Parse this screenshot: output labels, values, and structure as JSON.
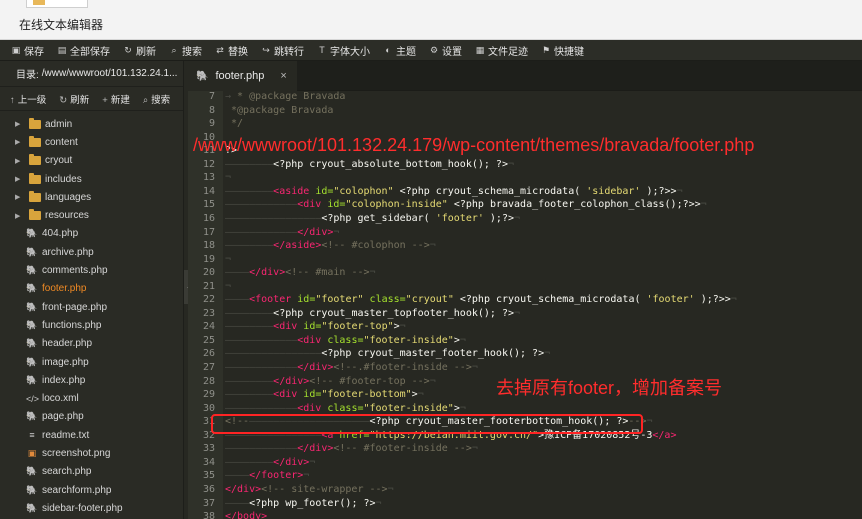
{
  "window": {
    "title": "在线文本编辑器"
  },
  "toolbar": {
    "items": [
      {
        "icon": "save-icon",
        "glyph": "▣",
        "label": "保存"
      },
      {
        "icon": "save-all-icon",
        "glyph": "▤",
        "label": "全部保存"
      },
      {
        "icon": "refresh-icon",
        "glyph": "↻",
        "label": "刷新"
      },
      {
        "icon": "search-icon",
        "glyph": "⌕",
        "label": "搜索"
      },
      {
        "icon": "replace-icon",
        "glyph": "⇄",
        "label": "替换"
      },
      {
        "icon": "goto-line-icon",
        "glyph": "↪",
        "label": "跳转行"
      },
      {
        "icon": "font-size-icon",
        "glyph": "T",
        "label": "字体大小"
      },
      {
        "icon": "theme-icon",
        "glyph": "◐",
        "label": "主题"
      },
      {
        "icon": "settings-icon",
        "glyph": "⚙",
        "label": "设置"
      },
      {
        "icon": "file-history-icon",
        "glyph": "▦",
        "label": "文件足迹"
      },
      {
        "icon": "shortcut-icon",
        "glyph": "⚑",
        "label": "快捷键"
      }
    ]
  },
  "sidebar": {
    "path_label": "目录:",
    "path_value": "/www/wwwroot/101.132.24.1...",
    "actions": [
      {
        "icon": "up-icon",
        "glyph": "↑",
        "label": "上一级"
      },
      {
        "icon": "refresh-icon",
        "glyph": "↻",
        "label": "刷新"
      },
      {
        "icon": "plus-icon",
        "glyph": "+",
        "label": "新建"
      },
      {
        "icon": "search-icon",
        "glyph": "⌕",
        "label": "搜索"
      }
    ],
    "folders": [
      "admin",
      "content",
      "cryout",
      "includes",
      "languages",
      "resources"
    ],
    "files": [
      {
        "name": "404.php",
        "type": "php"
      },
      {
        "name": "archive.php",
        "type": "php"
      },
      {
        "name": "comments.php",
        "type": "php"
      },
      {
        "name": "footer.php",
        "type": "php",
        "active": true
      },
      {
        "name": "front-page.php",
        "type": "php"
      },
      {
        "name": "functions.php",
        "type": "php"
      },
      {
        "name": "header.php",
        "type": "php"
      },
      {
        "name": "image.php",
        "type": "php"
      },
      {
        "name": "index.php",
        "type": "php"
      },
      {
        "name": "loco.xml",
        "type": "xml"
      },
      {
        "name": "page.php",
        "type": "php"
      },
      {
        "name": "readme.txt",
        "type": "txt"
      },
      {
        "name": "screenshot.png",
        "type": "png"
      },
      {
        "name": "search.php",
        "type": "php"
      },
      {
        "name": "searchform.php",
        "type": "php"
      },
      {
        "name": "sidebar-footer.php",
        "type": "php"
      }
    ]
  },
  "editor": {
    "tab_label": "footer.php",
    "tab_close": "×",
    "collapse_glyph": "❮",
    "lines": [
      {
        "n": "7",
        "segs": [
          [
            "ws",
            "→ "
          ],
          [
            "cmt",
            "* "
          ],
          [
            "cmt",
            "@package Bravada"
          ]
        ]
      },
      {
        "n": "8",
        "segs": [
          [
            "cmt",
            " *@package Bravada"
          ]
        ]
      },
      {
        "n": "9",
        "segs": [
          [
            "cmt",
            " */"
          ]
        ]
      },
      {
        "n": "10",
        "segs": [
          [
            "txt",
            ""
          ]
        ]
      },
      {
        "n": "11",
        "segs": [
          [
            "php",
            "?>"
          ]
        ]
      },
      {
        "n": "12",
        "segs": [
          [
            "ws",
            "————————"
          ],
          [
            "php",
            "<?php cryout_absolute_bottom_hook(); ?>"
          ],
          [
            "ws",
            "¬"
          ]
        ]
      },
      {
        "n": "13",
        "segs": [
          [
            "ws",
            "¬"
          ]
        ]
      },
      {
        "n": "14",
        "segs": [
          [
            "ws",
            "————————"
          ],
          [
            "tag",
            "<aside"
          ],
          [
            "php",
            " "
          ],
          [
            "attr",
            "id="
          ],
          [
            "str",
            "\"colophon\""
          ],
          [
            "php",
            " <?php cryout_schema_microdata( "
          ],
          [
            "str",
            "'sidebar'"
          ],
          [
            "php",
            " );?>>"
          ],
          [
            "ws",
            "¬"
          ]
        ]
      },
      {
        "n": "15",
        "segs": [
          [
            "ws",
            "————————————"
          ],
          [
            "tag",
            "<div"
          ],
          [
            "php",
            " "
          ],
          [
            "attr",
            "id="
          ],
          [
            "str",
            "\"colophon-inside\""
          ],
          [
            "php",
            " <?php bravada_footer_colophon_class();?>>"
          ],
          [
            "ws",
            "¬"
          ]
        ]
      },
      {
        "n": "16",
        "segs": [
          [
            "ws",
            "————————————————"
          ],
          [
            "php",
            "<?php get_sidebar( "
          ],
          [
            "str",
            "'footer'"
          ],
          [
            "php",
            " );?>"
          ],
          [
            "ws",
            "¬"
          ]
        ]
      },
      {
        "n": "17",
        "segs": [
          [
            "ws",
            "————————————"
          ],
          [
            "tag",
            "</div>"
          ],
          [
            "ws",
            "¬"
          ]
        ]
      },
      {
        "n": "18",
        "segs": [
          [
            "ws",
            "————————"
          ],
          [
            "tag",
            "</aside>"
          ],
          [
            "cmt",
            "<!-- #colophon -->"
          ],
          [
            "ws",
            "¬"
          ]
        ]
      },
      {
        "n": "19",
        "segs": [
          [
            "ws",
            "¬"
          ]
        ]
      },
      {
        "n": "20",
        "segs": [
          [
            "ws",
            "————"
          ],
          [
            "tag",
            "</div>"
          ],
          [
            "cmt",
            "<!-- #main -->"
          ],
          [
            "ws",
            "¬"
          ]
        ]
      },
      {
        "n": "21",
        "segs": [
          [
            "ws",
            "¬"
          ]
        ]
      },
      {
        "n": "22",
        "segs": [
          [
            "ws",
            "————"
          ],
          [
            "tag",
            "<footer"
          ],
          [
            "php",
            " "
          ],
          [
            "attr",
            "id="
          ],
          [
            "str",
            "\"footer\""
          ],
          [
            "php",
            " "
          ],
          [
            "attr",
            "class="
          ],
          [
            "str",
            "\"cryout\""
          ],
          [
            "php",
            " <?php cryout_schema_microdata( "
          ],
          [
            "str",
            "'footer'"
          ],
          [
            "php",
            " );?>>"
          ],
          [
            "ws",
            "¬"
          ]
        ]
      },
      {
        "n": "23",
        "segs": [
          [
            "ws",
            "————————"
          ],
          [
            "php",
            "<?php cryout_master_topfooter_hook(); ?>"
          ],
          [
            "ws",
            "¬"
          ]
        ]
      },
      {
        "n": "24",
        "segs": [
          [
            "ws",
            "————————"
          ],
          [
            "tag",
            "<div"
          ],
          [
            "php",
            " "
          ],
          [
            "attr",
            "id="
          ],
          [
            "str",
            "\"footer-top\""
          ],
          [
            "php",
            ">"
          ],
          [
            "ws",
            "¬"
          ]
        ]
      },
      {
        "n": "25",
        "segs": [
          [
            "ws",
            "————————————"
          ],
          [
            "tag",
            "<div"
          ],
          [
            "php",
            " "
          ],
          [
            "attr",
            "class="
          ],
          [
            "str",
            "\"footer-inside\""
          ],
          [
            "php",
            ">"
          ],
          [
            "ws",
            "¬"
          ]
        ]
      },
      {
        "n": "26",
        "segs": [
          [
            "ws",
            "————————————————"
          ],
          [
            "php",
            "<?php cryout_master_footer_hook(); ?>"
          ],
          [
            "ws",
            "¬"
          ]
        ]
      },
      {
        "n": "27",
        "segs": [
          [
            "ws",
            "————————————"
          ],
          [
            "tag",
            "</div>"
          ],
          [
            "cmt",
            "<!--.#footer-inside -->"
          ],
          [
            "ws",
            "¬"
          ]
        ]
      },
      {
        "n": "28",
        "segs": [
          [
            "ws",
            "————————"
          ],
          [
            "tag",
            "</div>"
          ],
          [
            "cmt",
            "<!-- #footer-top -->"
          ],
          [
            "ws",
            "¬"
          ]
        ]
      },
      {
        "n": "29",
        "segs": [
          [
            "ws",
            "————————"
          ],
          [
            "tag",
            "<div"
          ],
          [
            "php",
            " "
          ],
          [
            "attr",
            "id="
          ],
          [
            "str",
            "\"footer-bottom\""
          ],
          [
            "php",
            ">"
          ],
          [
            "ws",
            "¬"
          ]
        ]
      },
      {
        "n": "30",
        "segs": [
          [
            "ws",
            "————————————"
          ],
          [
            "tag",
            "<div"
          ],
          [
            "php",
            " "
          ],
          [
            "attr",
            "class="
          ],
          [
            "str",
            "\"footer-inside\""
          ],
          [
            "php",
            ">"
          ],
          [
            "ws",
            "¬"
          ]
        ]
      },
      {
        "n": "31",
        "segs": [
          [
            "cmt",
            "<!--"
          ],
          [
            "ws",
            "————————————————————"
          ],
          [
            "php",
            "<?php cryout_master_footerbottom_hook(); ?>"
          ],
          [
            "cmt",
            "-->"
          ],
          [
            "ws",
            "¬"
          ]
        ]
      },
      {
        "n": "32",
        "segs": [
          [
            "ws",
            "————————————————"
          ],
          [
            "tag",
            "<a"
          ],
          [
            "php",
            " "
          ],
          [
            "attr",
            "href="
          ],
          [
            "str",
            "\"https://beian.miit.gov.cn/\""
          ],
          [
            "php",
            ">豫ICP备17020852号-3"
          ],
          [
            "tag",
            "</a>"
          ]
        ]
      },
      {
        "n": "33",
        "segs": [
          [
            "ws",
            "————————————"
          ],
          [
            "tag",
            "</div>"
          ],
          [
            "cmt",
            "<!-- #footer-inside -->"
          ],
          [
            "ws",
            "¬"
          ]
        ]
      },
      {
        "n": "34",
        "segs": [
          [
            "ws",
            "————————"
          ],
          [
            "tag",
            "</div>"
          ],
          [
            "ws",
            "¬"
          ]
        ]
      },
      {
        "n": "35",
        "segs": [
          [
            "ws",
            "————"
          ],
          [
            "tag",
            "</footer>"
          ],
          [
            "ws",
            "¬"
          ]
        ]
      },
      {
        "n": "36",
        "segs": [
          [
            "tag",
            "</div>"
          ],
          [
            "cmt",
            "<!-- site-wrapper -->"
          ],
          [
            "ws",
            "¬"
          ]
        ]
      },
      {
        "n": "37",
        "segs": [
          [
            "ws",
            "————"
          ],
          [
            "php",
            "<?php wp_footer(); ?>"
          ],
          [
            "ws",
            "¬"
          ]
        ]
      },
      {
        "n": "38",
        "segs": [
          [
            "tag",
            "</body>"
          ]
        ]
      }
    ]
  },
  "annotations": {
    "path_note": "/www/wwwroot/101.132.24.179/wp-content/themes/bravada/footer.php",
    "note": "去掉原有footer，增加备案号"
  },
  "colors": {
    "accent_text": "#f08a24",
    "annotation": "#ff2d2d",
    "editor_bg": "#272822"
  }
}
